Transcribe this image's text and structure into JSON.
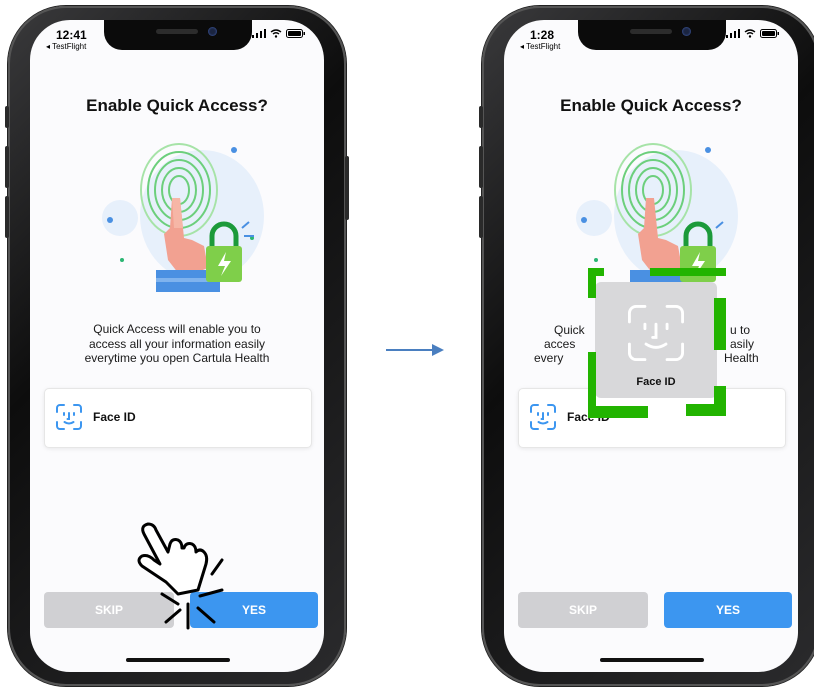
{
  "phones": [
    {
      "status": {
        "time": "12:41",
        "back_app": "◂ TestFlight"
      },
      "title": "Enable Quick Access?",
      "description": [
        "Quick Access will enable you to",
        "access all your information easily",
        "everytime you open Cartula Health"
      ],
      "option": {
        "label": "Face ID",
        "icon": "face-id-icon"
      },
      "skip_label": "SKIP",
      "yes_label": "YES"
    },
    {
      "status": {
        "time": "1:28",
        "back_app": "◂ TestFlight"
      },
      "title": "Enable Quick Access?",
      "description": [
        "Quick",
        "u to",
        "acces",
        "asily",
        "every",
        "Health"
      ],
      "option": {
        "label": "Face ID",
        "icon": "face-id-icon"
      },
      "skip_label": "SKIP",
      "yes_label": "YES",
      "faceid_prompt": {
        "label": "Face ID"
      }
    }
  ],
  "colors": {
    "primary_blue": "#3c96f0",
    "skip_gray": "#d0d0d3",
    "highlight_green": "#22b400",
    "arrow_blue": "#4a7fc0"
  }
}
